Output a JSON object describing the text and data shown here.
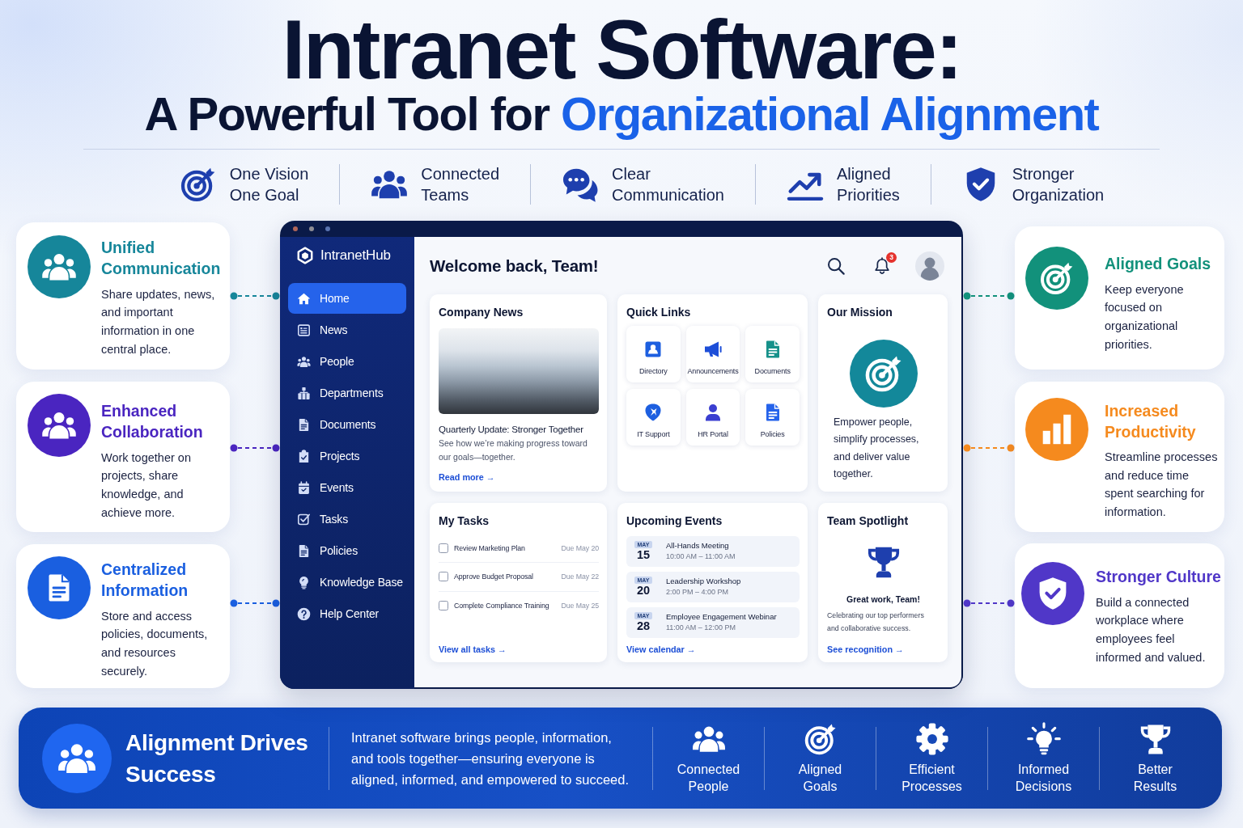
{
  "header": {
    "title": "Intranet Software:",
    "subtitle": "A Powerful Tool for",
    "subtitle_accent": "Organizational Alignment"
  },
  "pillars": [
    {
      "kind": "target",
      "label": "One Vision\nOne Goal"
    },
    {
      "kind": "people",
      "label": "Connected\nTeams"
    },
    {
      "kind": "chat",
      "label": "Clear\nCommunication"
    },
    {
      "kind": "trend",
      "label": "Aligned\nPriorities"
    },
    {
      "kind": "shield",
      "label": "Stronger\nOrganization"
    }
  ],
  "left_features": [
    {
      "kind": "people",
      "color": "#16869a",
      "title": "Unified Communication",
      "text": "Share updates, news, and important information in one central place."
    },
    {
      "kind": "people",
      "color": "#4a25c0",
      "title": "Enhanced Collaboration",
      "text": "Work together on projects, share knowledge, and achieve more."
    },
    {
      "kind": "document",
      "color": "#1a5fe0",
      "title": "Centralized Information",
      "text": "Store and access policies, documents, and resources securely."
    }
  ],
  "dashboard": {
    "brand": "IntranetHub",
    "nav": [
      {
        "kind": "home",
        "label": "Home",
        "selected": true
      },
      {
        "kind": "news",
        "label": "News",
        "selected": false
      },
      {
        "kind": "people",
        "label": "People",
        "selected": false
      },
      {
        "kind": "departments",
        "label": "Departments",
        "selected": false
      },
      {
        "kind": "documents",
        "label": "Documents",
        "selected": false
      },
      {
        "kind": "projects",
        "label": "Projects",
        "selected": false
      },
      {
        "kind": "events",
        "label": "Events",
        "selected": false
      },
      {
        "kind": "tasks",
        "label": "Tasks",
        "selected": false
      },
      {
        "kind": "policies",
        "label": "Policies",
        "selected": false
      },
      {
        "kind": "knowledge",
        "label": "Knowledge Base",
        "selected": false
      },
      {
        "kind": "help",
        "label": "Help Center",
        "selected": false
      }
    ],
    "greeting": "Welcome back, Team!",
    "notifications": "3",
    "company_news": {
      "title": "Company News",
      "headline": "Quarterly Update: Stronger Together",
      "summary": "See how we’re making progress toward our goals—together.",
      "link": "Read more →"
    },
    "quick_links": {
      "title": "Quick Links",
      "items": [
        {
          "kind": "directory",
          "label": "Directory"
        },
        {
          "kind": "announcements",
          "label": "Announcements"
        },
        {
          "kind": "documents",
          "label": "Documents"
        },
        {
          "kind": "support",
          "label": "IT Support"
        },
        {
          "kind": "person",
          "label": "HR Portal"
        },
        {
          "kind": "policies",
          "label": "Policies"
        }
      ]
    },
    "mission": {
      "title": "Our Mission",
      "text": "Empower people, simplify processes, and deliver value together."
    },
    "tasks": {
      "title": "My Tasks",
      "items": [
        {
          "label": "Review Marketing Plan",
          "due": "Due May 20",
          "checked": false
        },
        {
          "label": "Approve Budget Proposal",
          "due": "Due May 22",
          "checked": false
        },
        {
          "label": "Complete Compliance Training",
          "due": "Due May 25",
          "checked": false
        }
      ],
      "link": "View all tasks →"
    },
    "events": {
      "title": "Upcoming Events",
      "items": [
        {
          "month": "MAY",
          "day": "15",
          "title": "All-Hands Meeting",
          "time": "10:00 AM – 11:00 AM"
        },
        {
          "month": "MAY",
          "day": "20",
          "title": "Leadership Workshop",
          "time": "2:00 PM – 4:00 PM"
        },
        {
          "month": "MAY",
          "day": "28",
          "title": "Employee Engagement Webinar",
          "time": "11:00 AM – 12:00 PM"
        }
      ],
      "link": "View calendar →"
    },
    "spotlight": {
      "title": "Team Spotlight",
      "headline": "Great work, Team!",
      "text": "Celebrating our top performers and collaborative success.",
      "link": "See recognition →"
    }
  },
  "right_features": [
    {
      "kind": "target",
      "color": "#12917b",
      "title": "Aligned Goals",
      "text": "Keep everyone focused on organizational priorities."
    },
    {
      "kind": "bars",
      "color": "#f58a1e",
      "title": "Increased Productivity",
      "text": "Streamline processes and reduce time spent searching for information."
    },
    {
      "kind": "shield",
      "color": "#5037c8",
      "title": "Stronger Culture",
      "text": "Build a connected workplace where employees feel informed and valued."
    }
  ],
  "banner": {
    "title": "Alignment Drives Success",
    "text": "Intranet software brings people, information,\nand tools together—ensuring everyone is\naligned, informed, and empowered to succeed.",
    "items": [
      {
        "kind": "people",
        "label": "Connected\nPeople"
      },
      {
        "kind": "target",
        "label": "Aligned\nGoals"
      },
      {
        "kind": "gear",
        "label": "Efficient\nProcesses"
      },
      {
        "kind": "bulb",
        "label": "Informed\nDecisions"
      },
      {
        "kind": "trophy",
        "label": "Better\nResults"
      }
    ]
  }
}
